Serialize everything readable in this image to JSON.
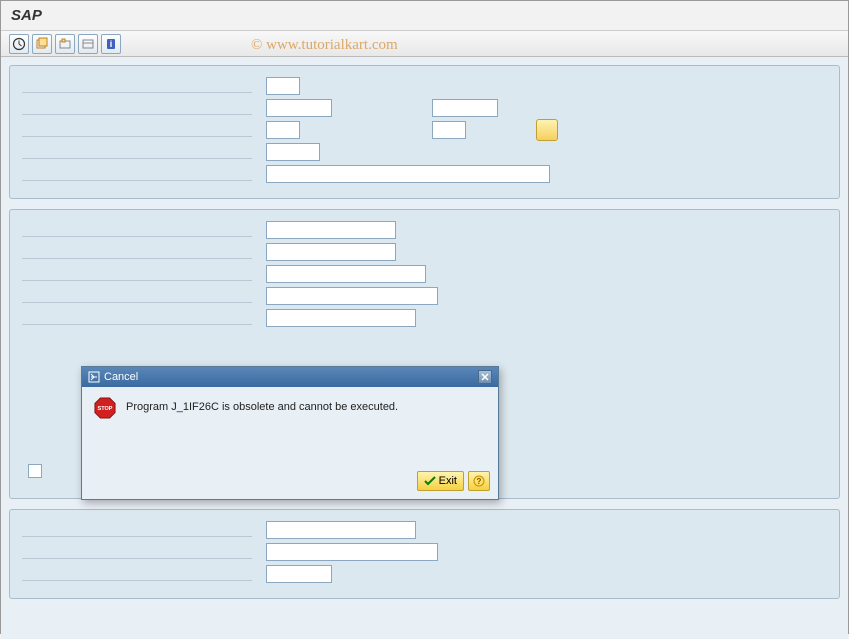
{
  "window": {
    "title": "SAP"
  },
  "watermark": "© www.tutorialkart.com",
  "dialog": {
    "title": "Cancel",
    "message": "Program J_1IF26C is obsolete and cannot be executed.",
    "exit_label": "Exit"
  }
}
